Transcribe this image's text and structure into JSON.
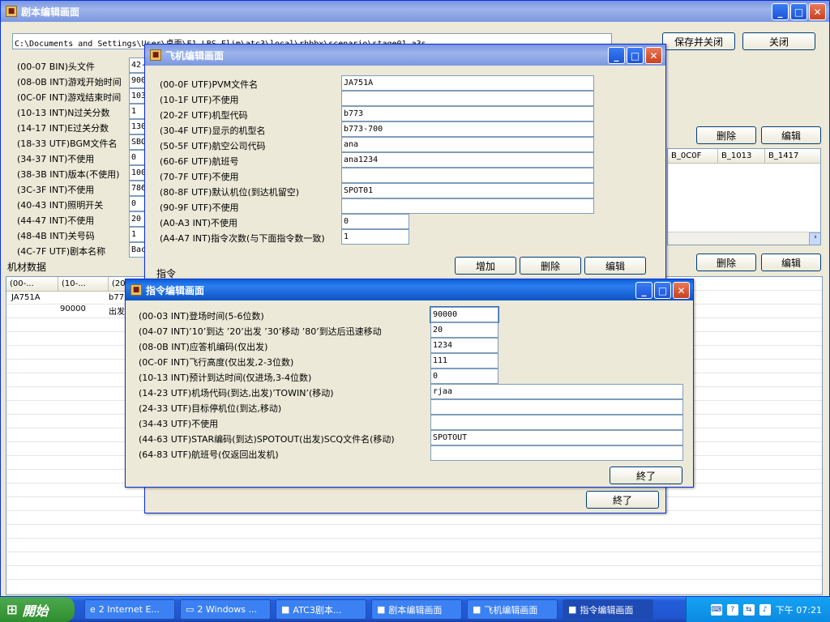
{
  "main": {
    "title": "剧本编辑画面",
    "path": "C:\\Documents and Settings\\User\\桌面\\E1_LBS_Flim\\atc3\\local\\rhbbx\\scenario\\stage01.a3s",
    "save_close": "保存并关闭",
    "close": "关闭",
    "fields": [
      {
        "label": "(00-07 BIN)头文件",
        "value": "42-"
      },
      {
        "label": "(08-0B INT)游戏开始时间",
        "value": "900"
      },
      {
        "label": "(0C-0F INT)游戏结束时间",
        "value": "103"
      },
      {
        "label": "(10-13 INT)N过关分数",
        "value": "1"
      },
      {
        "label": "(14-17 INT)E过关分数",
        "value": "130"
      },
      {
        "label": "(18-33 UTF)BGM文件名",
        "value": "SBG"
      },
      {
        "label": "(34-37 INT)不使用",
        "value": "0"
      },
      {
        "label": "(38-3B INT)版本(不使用)",
        "value": "100"
      },
      {
        "label": "(3C-3F INT)不使用",
        "value": "786"
      },
      {
        "label": "(40-43 INT)照明开关",
        "value": "0"
      },
      {
        "label": "(44-47 INT)不使用",
        "value": "20"
      },
      {
        "label": "(48-4B INT)关号码",
        "value": "1"
      },
      {
        "label": "(4C-7F UTF)剧本名称",
        "value": "Bac"
      }
    ],
    "delete1": "删除",
    "edit1": "编辑",
    "delete2": "删除",
    "edit2": "编辑",
    "rgrid_headers": [
      "B_0C0F",
      "B_1013",
      "B_1417"
    ],
    "equip_label": "机材数据",
    "egrid_headers": [
      "(00-...",
      "(10-...",
      "(20"
    ],
    "egrid_rows": [
      [
        "JA751A",
        "",
        "b773"
      ],
      [
        "",
        "90000",
        "出发"
      ]
    ]
  },
  "plane": {
    "title": "飞机编辑画面",
    "fields": [
      {
        "label": "(00-0F UTF)PVM文件名",
        "value": "JA751A"
      },
      {
        "label": "(10-1F UTF)不使用",
        "value": ""
      },
      {
        "label": "(20-2F UTF)机型代码",
        "value": "b773"
      },
      {
        "label": "(30-4F UTF)显示的机型名",
        "value": "b773-700"
      },
      {
        "label": "(50-5F UTF)航空公司代码",
        "value": "ana"
      },
      {
        "label": "(60-6F UTF)航班号",
        "value": "ana1234"
      },
      {
        "label": "(70-7F UTF)不使用",
        "value": ""
      },
      {
        "label": "(80-8F UTF)默认机位(到达机留空)",
        "value": "SPOT01"
      },
      {
        "label": "(90-9F UTF)不使用",
        "value": ""
      },
      {
        "label": "(A0-A3 INT)不使用",
        "value": "0"
      },
      {
        "label": "(A4-A7 INT)指令次数(与下面指令数一致)",
        "value": "1"
      }
    ],
    "cmd_label": "指令",
    "add": "增加",
    "delete": "删除",
    "edit": "编辑",
    "done": "終了"
  },
  "cmd": {
    "title": "指令编辑画面",
    "fields": [
      {
        "label": "(00-03 INT)登场时间(5-6位数)",
        "value": "90000"
      },
      {
        "label": "(04-07 INT)’10’到达 ’20’出发 ’30’移动 ’80’到达后迅速移动",
        "value": "20"
      },
      {
        "label": "(08-0B INT)应答机编码(仅出发)",
        "value": "1234"
      },
      {
        "label": "(0C-0F INT)飞行高度(仅出发,2-3位数)",
        "value": "111"
      },
      {
        "label": "(10-13 INT)预计到达时间(仅进场,3-4位数)",
        "value": "0"
      },
      {
        "label": "(14-23 UTF)机场代码(到达,出发)’TOWIN’(移动)",
        "value": "rjaa"
      },
      {
        "label": "(24-33 UTF)目标停机位(到达,移动)",
        "value": ""
      },
      {
        "label": "(34-43 UTF)不使用",
        "value": ""
      },
      {
        "label": "(44-63 UTF)STAR编码(到达)SPOTOUT(出发)SCQ文件名(移动)",
        "value": "SPOTOUT"
      },
      {
        "label": "(64-83 UTF)航班号(仅返回出发机)",
        "value": ""
      }
    ],
    "done": "終了"
  },
  "taskbar": {
    "start": "開始",
    "items": [
      "2 Internet E...",
      "2 Windows ...",
      "ATC3剧本...",
      "剧本编辑画面",
      "飞机编辑画面",
      "指令编辑画面"
    ],
    "clock": "下午 07:21"
  },
  "colors": {
    "title_active": "#0a5fd8",
    "title_inactive": "#7a96df",
    "window_bg": "#ece9d8",
    "taskbar": "#245edb"
  }
}
